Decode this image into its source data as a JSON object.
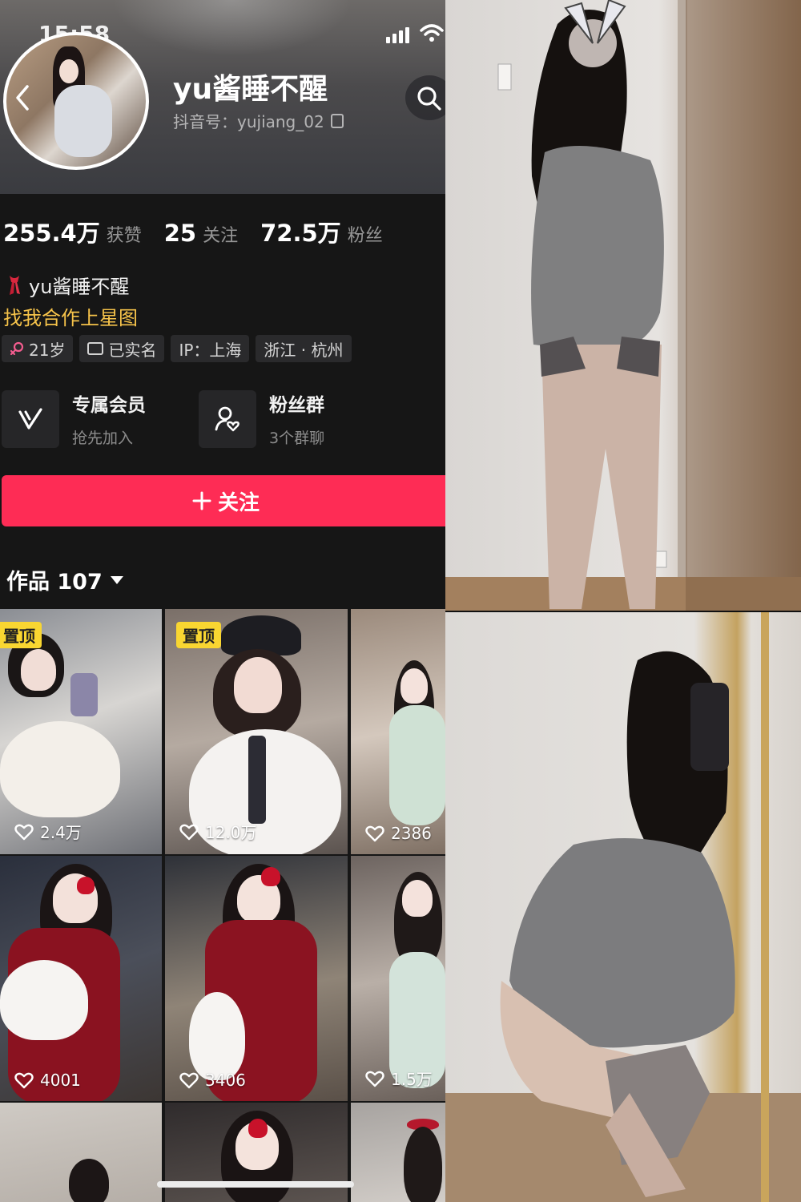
{
  "status_bar": {
    "time": "15:58"
  },
  "profile": {
    "nickname": "yu酱睡不醒",
    "douyin_id": "抖音号：yujiang_02",
    "stats": [
      {
        "value": "255.4万",
        "label": "获赞"
      },
      {
        "value": "25",
        "label": "关注"
      },
      {
        "value": "72.5万",
        "label": "粉丝"
      }
    ],
    "bio_name": "yu酱睡不醒",
    "bio_link": "找我合作上星图",
    "tags": [
      "21岁",
      "已实名",
      "IP：上海",
      "浙江 · 杭州"
    ]
  },
  "entries": {
    "member": {
      "title": "专属会员",
      "subtitle": "抢先加入"
    },
    "fan_group": {
      "title": "粉丝群",
      "subtitle": "3个群聊"
    }
  },
  "follow_button": {
    "label": "关注"
  },
  "works_tab": {
    "label": "作品 107"
  },
  "videos": [
    {
      "likes": "2.4万",
      "pinned": "置顶"
    },
    {
      "likes": "12.0万",
      "pinned": "置顶"
    },
    {
      "likes": "2386"
    },
    {
      "likes": "4001"
    },
    {
      "likes": "3406"
    },
    {
      "likes": "1.5万"
    },
    {
      "likes": ""
    },
    {
      "likes": ""
    },
    {
      "likes": ""
    }
  ],
  "colors": {
    "follow": "#fe2c55",
    "pin_badge": "#f9d631",
    "bio_link": "#f6c34a"
  },
  "icons": [
    "back-icon",
    "search-icon",
    "copy-icon",
    "vip-icon",
    "fan-group-icon",
    "plus-icon",
    "heart-icon",
    "caret-down-icon"
  ]
}
